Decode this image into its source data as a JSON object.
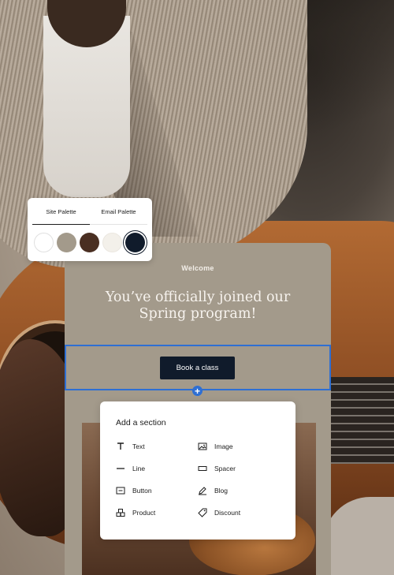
{
  "palette": {
    "tabs": [
      {
        "label": "Site Palette",
        "active": true
      },
      {
        "label": "Email Palette",
        "active": false
      }
    ],
    "swatches": [
      "#ffffff",
      "#a39a8b",
      "#4a2f22",
      "#f3f0ea",
      "#101b2b"
    ],
    "selected_swatch": "#101b2b"
  },
  "email": {
    "welcome": "Welcome",
    "headline": "You’ve officially joined our Spring program!",
    "button_label": "Book a class",
    "selection_color": "#2e6fd3",
    "add_handle_symbol": "+"
  },
  "add_section": {
    "title": "Add a section",
    "items": [
      {
        "label": "Text",
        "icon": "text-icon"
      },
      {
        "label": "Image",
        "icon": "image-icon"
      },
      {
        "label": "Line",
        "icon": "line-icon"
      },
      {
        "label": "Spacer",
        "icon": "spacer-icon"
      },
      {
        "label": "Button",
        "icon": "button-icon"
      },
      {
        "label": "Blog",
        "icon": "blog-icon"
      },
      {
        "label": "Product",
        "icon": "product-icon"
      },
      {
        "label": "Discount",
        "icon": "discount-icon"
      }
    ]
  }
}
